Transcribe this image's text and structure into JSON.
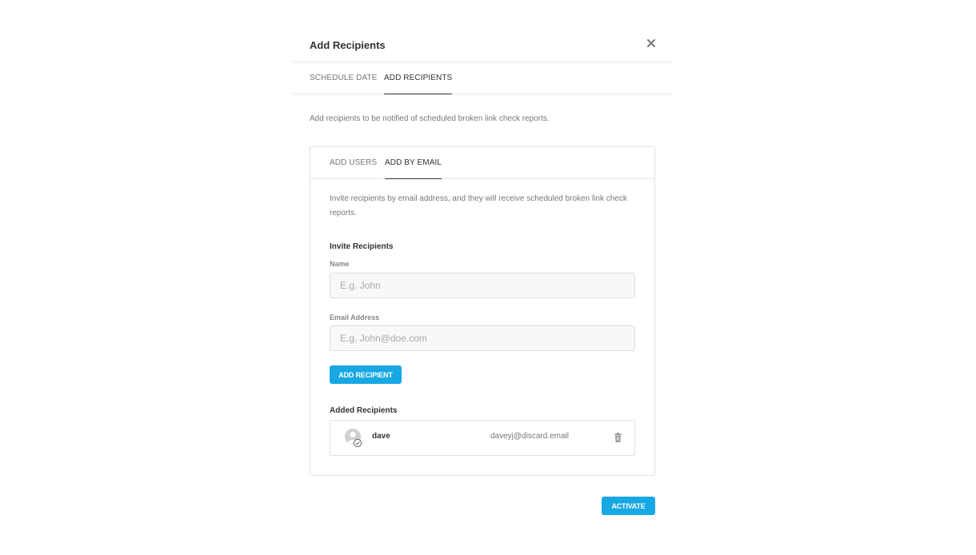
{
  "modal": {
    "title": "Add Recipients",
    "close_icon": "close-icon"
  },
  "outer_tabs": [
    {
      "label": "SCHEDULE DATE",
      "active": false
    },
    {
      "label": "ADD RECIPIENTS",
      "active": true
    }
  ],
  "intro_text": "Add recipients to be notified of scheduled broken link check reports.",
  "inner_tabs": [
    {
      "label": "ADD USERS",
      "active": false
    },
    {
      "label": "ADD BY EMAIL",
      "active": true
    }
  ],
  "by_email": {
    "description": "Invite recipients by email address, and they will receive scheduled broken link check reports.",
    "section_title": "Invite Recipients",
    "name_label": "Name",
    "name_placeholder": "E.g. John",
    "email_label": "Email Address",
    "email_placeholder": "E.g. John@doe.com",
    "add_button": "ADD RECIPIENT",
    "added_title": "Added Recipients",
    "recipients": [
      {
        "name": "dave",
        "email": "daveyj@discard.email",
        "avatar_icon": "user-avatar-icon",
        "remove_icon": "trash-icon"
      }
    ]
  },
  "footer": {
    "activate_button": "ACTIVATE"
  },
  "colors": {
    "accent": "#17a8e3",
    "border": "#e2e2e2",
    "muted_text": "#777777"
  }
}
